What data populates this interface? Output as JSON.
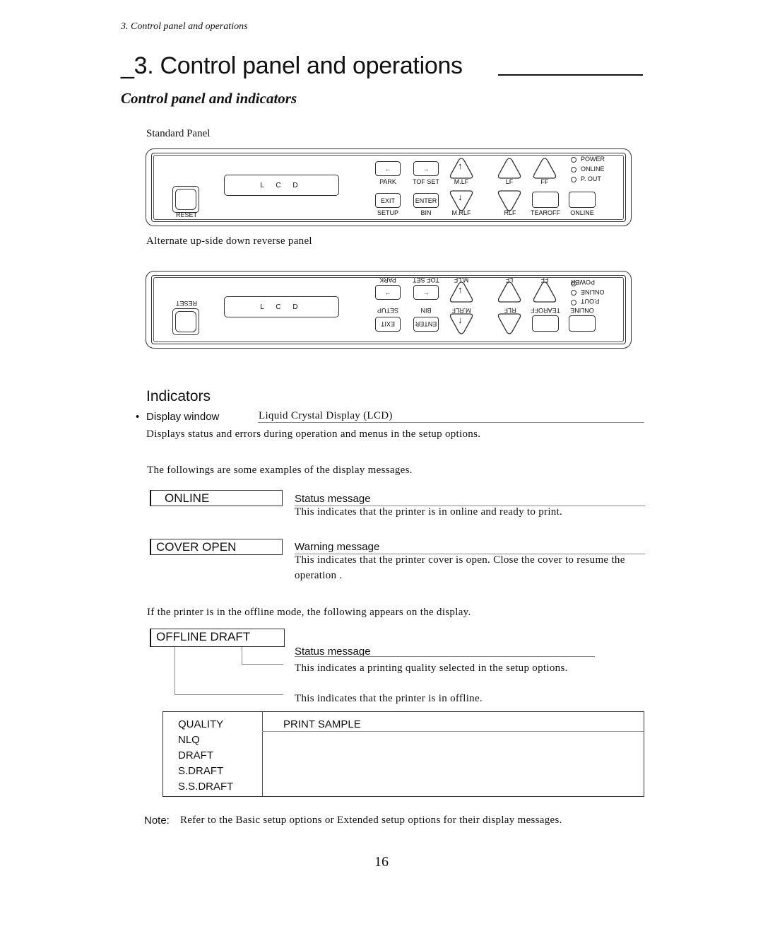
{
  "running_head": "3.  Control panel and operations",
  "chapter_title": "_3. Control panel and operations",
  "section_title": "Control panel and indicators",
  "standard_panel": {
    "caption": "Standard Panel",
    "lcd_label": "L C D",
    "reset_label": "RESET",
    "keys": [
      {
        "glyph": "←",
        "label": "PARK"
      },
      {
        "glyph": "→",
        "label": "TOF SET"
      },
      {
        "glyph": "↑",
        "label": "M.LF",
        "shape": "triangle-up"
      },
      {
        "glyph": "EXIT",
        "label": "SETUP"
      },
      {
        "glyph": "ENTER",
        "label": "BIN"
      },
      {
        "glyph": "↓",
        "label": "M.RLF",
        "shape": "triangle-down"
      },
      {
        "glyph": "",
        "label": "LF",
        "shape": "triangle-up"
      },
      {
        "glyph": "",
        "label": "FF",
        "shape": "triangle-up"
      },
      {
        "glyph": "",
        "label": "RLF",
        "shape": "triangle-down"
      },
      {
        "glyph": "",
        "label": "TEAROFF"
      },
      {
        "glyph": "",
        "label": "ONLINE"
      }
    ],
    "leds": [
      "POWER",
      "ONLINE",
      "P. OUT"
    ]
  },
  "alternate_panel": {
    "caption": "Alternate up-side down reverse panel",
    "lcd_label": "L C D",
    "reset_label": "RESET",
    "keys": [
      {
        "glyph": "←",
        "label": "PARK"
      },
      {
        "glyph": "→",
        "label": "TOF SET"
      },
      {
        "glyph": "↑",
        "label": "M.LF"
      },
      {
        "glyph": "EXIT",
        "label": "SETUP"
      },
      {
        "glyph": "ENTER",
        "label": "BIN"
      },
      {
        "glyph": "↓",
        "label": "M.RLF"
      },
      {
        "glyph": "",
        "label": "LF"
      },
      {
        "glyph": "",
        "label": "FF"
      },
      {
        "glyph": "",
        "label": "RLF"
      },
      {
        "glyph": "",
        "label": "TEAROFF"
      },
      {
        "glyph": "",
        "label": "ONLINE"
      }
    ],
    "leds": [
      "POWER",
      "ONLINE",
      "P.OUT"
    ]
  },
  "indicators": {
    "heading": "Indicators",
    "bullet": "•",
    "display_window_term": "Display window",
    "display_window_def": "Liquid Crystal Display (LCD)",
    "display_window_desc": "Displays status and errors during operation and menus in the setup options.",
    "examples_intro": "The followings are some examples of the display messages.",
    "messages": [
      {
        "display": "ONLINE",
        "type": "Status message",
        "description": "This indicates that the printer is in online and ready to print."
      },
      {
        "display": "COVER OPEN",
        "type": "Warning message",
        "description": "This indicates that the printer cover is open.  Close the cover to resume the operation ."
      }
    ],
    "offline_intro": "If the printer is in the offline mode, the following appears on the display.",
    "offline": {
      "display": "OFFLINE DRAFT",
      "type": "Status message",
      "quality_desc": "This indicates a printing quality selected in the setup options.",
      "offline_desc": "This indicates that the printer is in offline."
    }
  },
  "quality_table": {
    "headers": [
      "QUALITY",
      "PRINT SAMPLE"
    ],
    "rows": [
      "NLQ",
      "DRAFT",
      "S.DRAFT",
      "S.S.DRAFT"
    ]
  },
  "note": {
    "label": "Note:",
    "text": "Refer to the Basic setup options or Extended setup options for their display messages."
  },
  "page_number": "16"
}
